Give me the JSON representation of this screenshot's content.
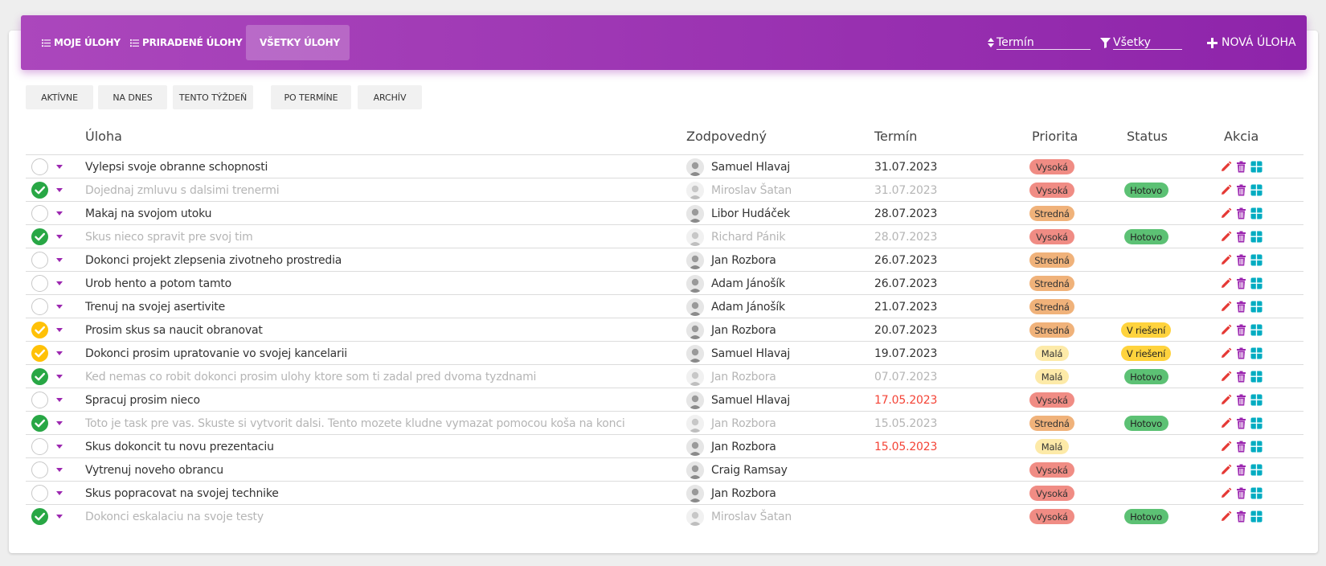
{
  "nav": {
    "tabs": [
      {
        "label": "MOJE ÚLOHY",
        "active": false
      },
      {
        "label": "PRIRADENÉ ÚLOHY",
        "active": false
      },
      {
        "label": "VŠETKY ÚLOHY",
        "active": true
      }
    ],
    "sort_value": "Termín",
    "filter_value": "Všetky",
    "new_task_label": "NOVÁ ÚLOHA"
  },
  "filters": [
    "AKTÍVNE",
    "NA DNES",
    "TENTO TÝŽDEŇ",
    "PO TERMÍNE",
    "ARCHÍV"
  ],
  "table": {
    "headers": {
      "task": "Úloha",
      "assignee": "Zodpovedný",
      "deadline": "Termín",
      "priority": "Priorita",
      "status": "Status",
      "action": "Akcia"
    },
    "rows": [
      {
        "check": "empty",
        "task": "Vylepsi svoje obranne schopnosti",
        "assignee": "Samuel Hlavaj",
        "deadline": "31.07.2023",
        "overdue": false,
        "priority": "Vysoká",
        "status": "",
        "done": false
      },
      {
        "check": "green",
        "task": "Dojednaj zmluvu s dalsimi trenermi",
        "assignee": "Miroslav Šatan",
        "deadline": "31.07.2023",
        "overdue": false,
        "priority": "Vysoká",
        "status": "Hotovo",
        "done": true
      },
      {
        "check": "empty",
        "task": "Makaj na svojom utoku",
        "assignee": "Libor Hudáček",
        "deadline": "28.07.2023",
        "overdue": false,
        "priority": "Stredná",
        "status": "",
        "done": false
      },
      {
        "check": "green",
        "task": "Skus nieco spravit pre svoj tim",
        "assignee": "Richard Pánik",
        "deadline": "28.07.2023",
        "overdue": false,
        "priority": "Vysoká",
        "status": "Hotovo",
        "done": true
      },
      {
        "check": "empty",
        "task": "Dokonci projekt zlepsenia zivotneho prostredia",
        "assignee": "Jan Rozbora",
        "deadline": "26.07.2023",
        "overdue": false,
        "priority": "Stredná",
        "status": "",
        "done": false
      },
      {
        "check": "empty",
        "task": "Urob hento a potom tamto",
        "assignee": "Adam Jánošík",
        "deadline": "26.07.2023",
        "overdue": false,
        "priority": "Stredná",
        "status": "",
        "done": false
      },
      {
        "check": "empty",
        "task": "Trenuj na svojej asertivite",
        "assignee": "Adam Jánošík",
        "deadline": "21.07.2023",
        "overdue": false,
        "priority": "Stredná",
        "status": "",
        "done": false
      },
      {
        "check": "yellow",
        "task": "Prosim skus sa naucit obranovat",
        "assignee": "Jan Rozbora",
        "deadline": "20.07.2023",
        "overdue": false,
        "priority": "Stredná",
        "status": "V riešení",
        "done": false
      },
      {
        "check": "yellow",
        "task": "Dokonci prosim upratovanie vo svojej kancelarii",
        "assignee": "Samuel Hlavaj",
        "deadline": "19.07.2023",
        "overdue": false,
        "priority": "Malá",
        "status": "V riešení",
        "done": false
      },
      {
        "check": "green",
        "task": "Ked nemas co robit dokonci prosim ulohy ktore som ti zadal pred dvoma tyzdnami",
        "assignee": "Jan Rozbora",
        "deadline": "07.07.2023",
        "overdue": false,
        "priority": "Malá",
        "status": "Hotovo",
        "done": true
      },
      {
        "check": "empty",
        "task": "Spracuj prosim nieco",
        "assignee": "Samuel Hlavaj",
        "deadline": "17.05.2023",
        "overdue": true,
        "priority": "Vysoká",
        "status": "",
        "done": false
      },
      {
        "check": "green",
        "task": "Toto je task pre vas. Skuste si vytvorit dalsi. Tento mozete kludne vymazat pomocou koša na konci",
        "assignee": "Jan Rozbora",
        "deadline": "15.05.2023",
        "overdue": false,
        "priority": "Stredná",
        "status": "Hotovo",
        "done": true
      },
      {
        "check": "empty",
        "task": "Skus dokoncit tu novu prezentaciu",
        "assignee": "Jan Rozbora",
        "deadline": "15.05.2023",
        "overdue": true,
        "priority": "Malá",
        "status": "",
        "done": false
      },
      {
        "check": "empty",
        "task": "Vytrenuj noveho obrancu",
        "assignee": "Craig Ramsay",
        "deadline": "",
        "overdue": false,
        "priority": "Vysoká",
        "status": "",
        "done": false
      },
      {
        "check": "empty",
        "task": "Skus popracovat na svojej technike",
        "assignee": "Jan Rozbora",
        "deadline": "",
        "overdue": false,
        "priority": "Vysoká",
        "status": "",
        "done": false
      },
      {
        "check": "green",
        "task": "Dokonci eskalaciu na svoje testy",
        "assignee": "Miroslav Šatan",
        "deadline": "",
        "overdue": false,
        "priority": "Vysoká",
        "status": "Hotovo",
        "done": true
      }
    ]
  },
  "colors": {
    "header_gradient_start": "#ab47bc",
    "header_gradient_end": "#8e24aa",
    "priority_high": "#f08c84",
    "priority_medium": "#f0b27a",
    "priority_low": "#fdeaa8",
    "status_done": "#5cc174",
    "status_in_progress": "#ffd33d",
    "overdue_text": "#f44336",
    "edit_icon": "#e53935",
    "delete_icon": "#9c27b0",
    "details_icon": "#00acc1"
  }
}
